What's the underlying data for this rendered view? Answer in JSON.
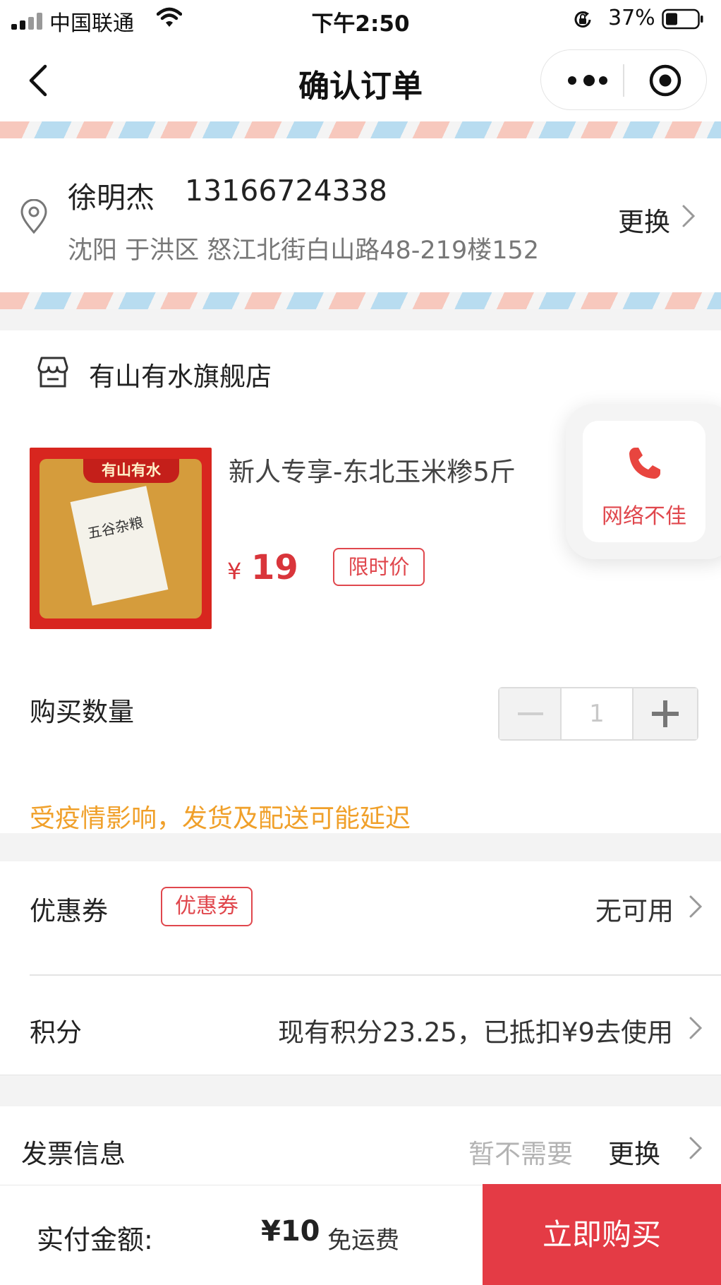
{
  "status_bar": {
    "carrier": "中国联通",
    "time": "下午2:50",
    "battery_percent": "37%"
  },
  "nav": {
    "title": "确认订单"
  },
  "address": {
    "name": "徐明杰",
    "phone": "13166724338",
    "detail": "沈阳 于洪区 怒江北街白山路48-219楼152",
    "change_label": "更换"
  },
  "store": {
    "name": "有山有水旗舰店"
  },
  "product": {
    "image_banner": "有山有水",
    "image_label": "五谷杂粮",
    "title": "新人专享-东北玉米糁5斤",
    "currency": "¥",
    "price": "19",
    "tag": "限时价"
  },
  "network_widget": {
    "label": "网络不佳"
  },
  "quantity": {
    "label": "购买数量",
    "value": "1"
  },
  "notice": "受疫情影响，发货及配送可能延迟",
  "coupon": {
    "label": "优惠券",
    "tag": "优惠券",
    "value": "无可用"
  },
  "points": {
    "label": "积分",
    "value": "现有积分23.25，已抵扣¥9去使用"
  },
  "invoice": {
    "label": "发票信息",
    "status": "暂不需要",
    "change_label": "更换"
  },
  "bottom_bar": {
    "pay_label": "实付金额:",
    "amount": "¥10",
    "shipping": "免运费",
    "buy_label": "立即购买"
  },
  "colors": {
    "accent_red": "#e43b45",
    "notice_orange": "#f0a02a"
  }
}
